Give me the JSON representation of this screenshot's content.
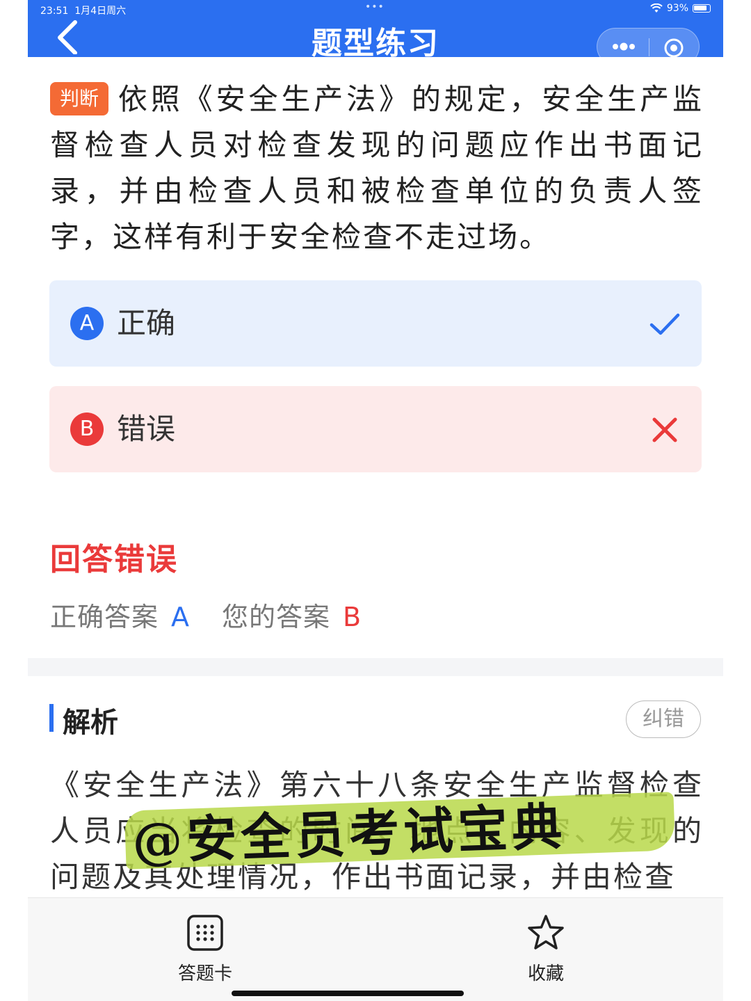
{
  "status_bar": {
    "time": "23:51",
    "date": "1月4日周六",
    "battery": "93%",
    "dots": "•••"
  },
  "nav": {
    "title": "题型练习",
    "back_icon": "chevron-left-icon",
    "more_icon": "more-dots-icon",
    "close_icon": "target-close-icon"
  },
  "question": {
    "type_tag": "判断",
    "text": "依照《安全生产法》的规定，安全生产监督检查人员对检查发现的问题应作出书面记录，并由检查人员和被检查单位的负责人签字，这样有利于安全检查不走过场。"
  },
  "options": [
    {
      "letter": "A",
      "label": "正确",
      "state": "correct",
      "mark_icon": "check-icon"
    },
    {
      "letter": "B",
      "label": "错误",
      "state": "wrong",
      "mark_icon": "cross-icon"
    }
  ],
  "result": {
    "title": "回答错误",
    "correct_label": "正确答案",
    "correct_value": "A",
    "yours_label": "您的答案",
    "yours_value": "B"
  },
  "analysis": {
    "title": "解析",
    "report_label": "纠错",
    "text": "《安全生产法》第六十八条安全生产监督检查人员应当将检查的时间、地点、内容、发现的问题及其处理情况，作出书面记录，并由检查"
  },
  "watermark": {
    "text": "@安全员考试宝典"
  },
  "tabbar": {
    "card_label": "答题卡",
    "fav_label": "收藏"
  },
  "colors": {
    "primary": "#2b6ff0",
    "error": "#ea3a3a",
    "tag": "#f46a35",
    "correct_bg": "#e8f0fd",
    "wrong_bg": "#fdeaea"
  }
}
